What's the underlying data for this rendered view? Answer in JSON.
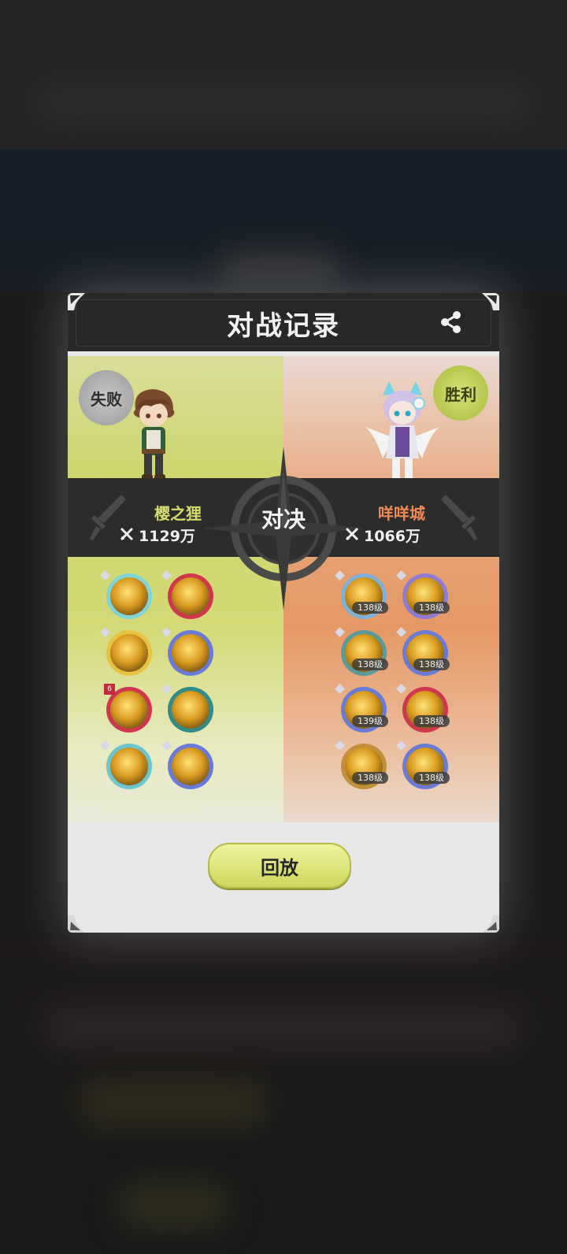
{
  "dialog": {
    "title": "对战记录",
    "vs_label": "对决",
    "replay_label": "回放"
  },
  "left_player": {
    "result": "失败",
    "name": "樱之狸",
    "power": "1129万",
    "skills": [
      {
        "icon": "golden-rune-skill-icon",
        "ring": "#7fd4d6"
      },
      {
        "icon": "crimson-ring-skill-icon",
        "ring": "#d1364f"
      },
      {
        "icon": "trident-skill-icon",
        "ring": "#e7c341"
      },
      {
        "icon": "beast-skill-icon",
        "ring": "#6a7bd6"
      },
      {
        "icon": "gold-shield-skill-icon",
        "ring": "#d1364f",
        "rank": "6"
      },
      {
        "icon": "hexagon-skill-icon",
        "ring": "#2f8c8a"
      },
      {
        "icon": "wind-slash-skill-icon",
        "ring": "#6cc6ce"
      },
      {
        "icon": "red-shield-skill-icon",
        "ring": "#6a7bd6"
      }
    ]
  },
  "right_player": {
    "result": "胜利",
    "name": "咩咩城",
    "power": "1066万",
    "skills": [
      {
        "icon": "burst-skill-icon",
        "level": "138级",
        "ring": "#7fb0d6"
      },
      {
        "icon": "sun-core-skill-icon",
        "level": "138级",
        "ring": "#8e7bd6"
      },
      {
        "icon": "sunrise-skill-icon",
        "level": "138级",
        "ring": "#5a9b9a"
      },
      {
        "icon": "claw-skill-icon",
        "level": "138级",
        "ring": "#6a7bd6"
      },
      {
        "icon": "swirl-skill-icon",
        "level": "139级",
        "ring": "#6a7bd6"
      },
      {
        "icon": "flame-orb-skill-icon",
        "level": "138级",
        "ring": "#d1364f"
      },
      {
        "icon": "lightning-skill-icon",
        "level": "138级",
        "ring": "#c28f3a"
      },
      {
        "icon": "arcane-circle-skill-icon",
        "level": "138级",
        "ring": "#6a7bd6"
      }
    ]
  },
  "colors": {
    "header": "#282828",
    "win_badge": "#b7c64e",
    "lose_badge": "#a7a7a7",
    "left_name": "#d6dd6a",
    "right_name": "#ef8a55",
    "replay_button": "#d1d65e"
  }
}
